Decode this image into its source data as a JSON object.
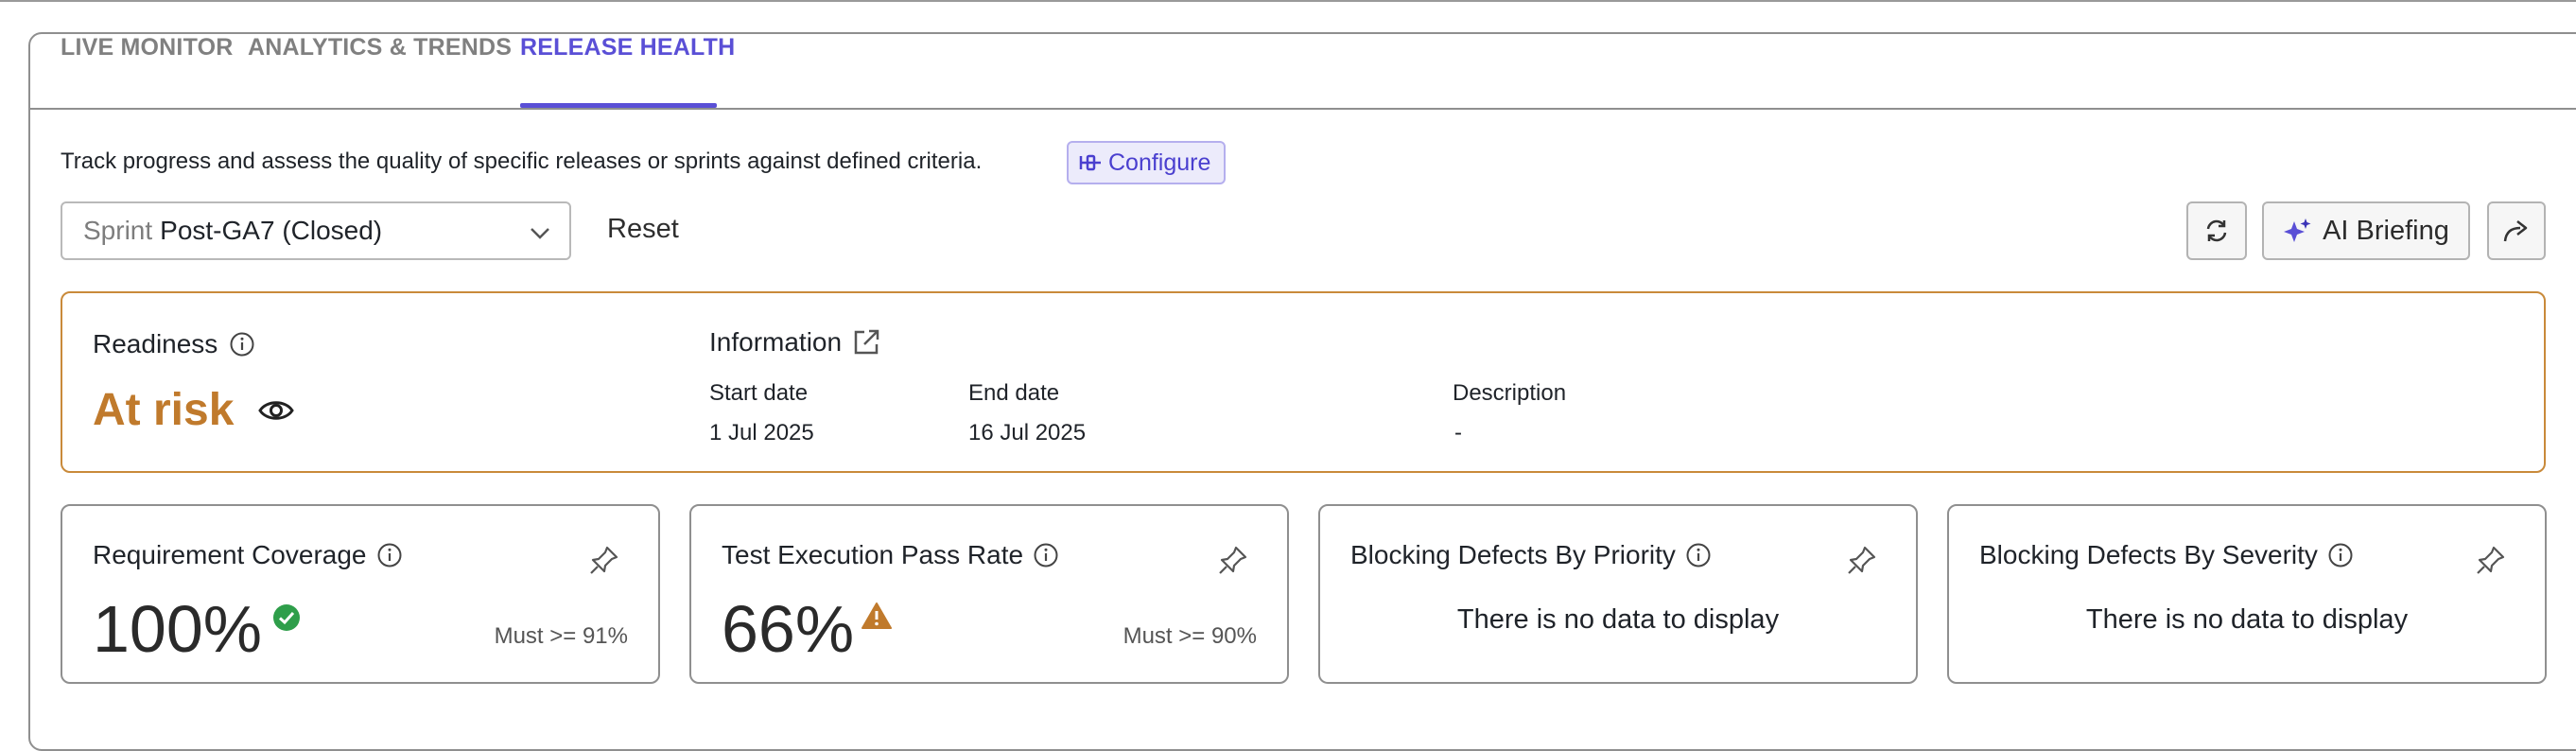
{
  "tabs": [
    {
      "label": "LIVE MONITOR"
    },
    {
      "label": "ANALYTICS & TRENDS"
    },
    {
      "label": "RELEASE HEALTH"
    }
  ],
  "description": "Track progress and assess the quality of specific releases or sprints against defined criteria.",
  "configure_label": "Configure",
  "sprint": {
    "prefix": "Sprint",
    "value": "Post-GA7 (Closed)"
  },
  "reset_label": "Reset",
  "ai_briefing_label": "AI Briefing",
  "readiness": {
    "label": "Readiness",
    "status": "At risk",
    "status_color": "#c07a2c"
  },
  "information": {
    "label": "Information",
    "start_date_label": "Start date",
    "start_date": "1 Jul 2025",
    "end_date_label": "End date",
    "end_date": "16 Jul 2025",
    "description_label": "Description",
    "description": "-"
  },
  "metrics": [
    {
      "title": "Requirement Coverage",
      "value": "100%",
      "threshold": "Must >= 91%",
      "status": "pass"
    },
    {
      "title": "Test Execution Pass Rate",
      "value": "66%",
      "threshold": "Must >= 90%",
      "status": "warning"
    },
    {
      "title": "Blocking Defects By Priority",
      "empty_text": "There is no data to display"
    },
    {
      "title": "Blocking Defects By Severity",
      "empty_text": "There is no data to display"
    }
  ],
  "colors": {
    "accent": "#5a4fd6",
    "warning": "#c07a2c",
    "success": "#2e9e4a"
  }
}
